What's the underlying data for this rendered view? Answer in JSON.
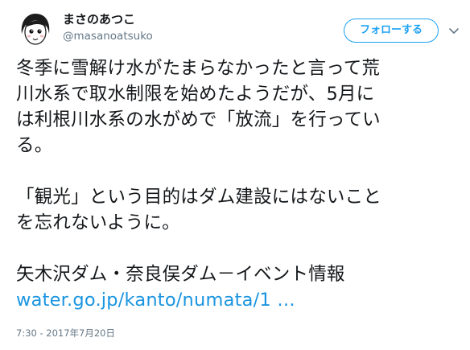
{
  "user": {
    "display_name": "まさのあつこ",
    "screen_name": "@masanoatsuko",
    "avatar_icon": "avatar-portrait-icon"
  },
  "header": {
    "follow_label": "フォローする",
    "menu_icon": "chevron-down-icon"
  },
  "tweet": {
    "lines": [
      "冬季に雪解け水がたまらなかったと言って荒",
      "川水系で取水制限を始めたようだが、5月に",
      "は利根川水系の水がめで「放流」を行ってい",
      "る。",
      "",
      "「観光」という目的はダム建設にはないこと",
      "を忘れないように。",
      "",
      "矢木沢ダム・奈良俣ダム－イベント情報"
    ],
    "link_text": "water.go.jp/kanto/numata/1 …",
    "timestamp": "7:30 - 2017年7月20日"
  },
  "colors": {
    "accent": "#1da1f2",
    "link": "#1b95e0",
    "secondary_text": "#657786",
    "primary_text": "#14171a"
  }
}
